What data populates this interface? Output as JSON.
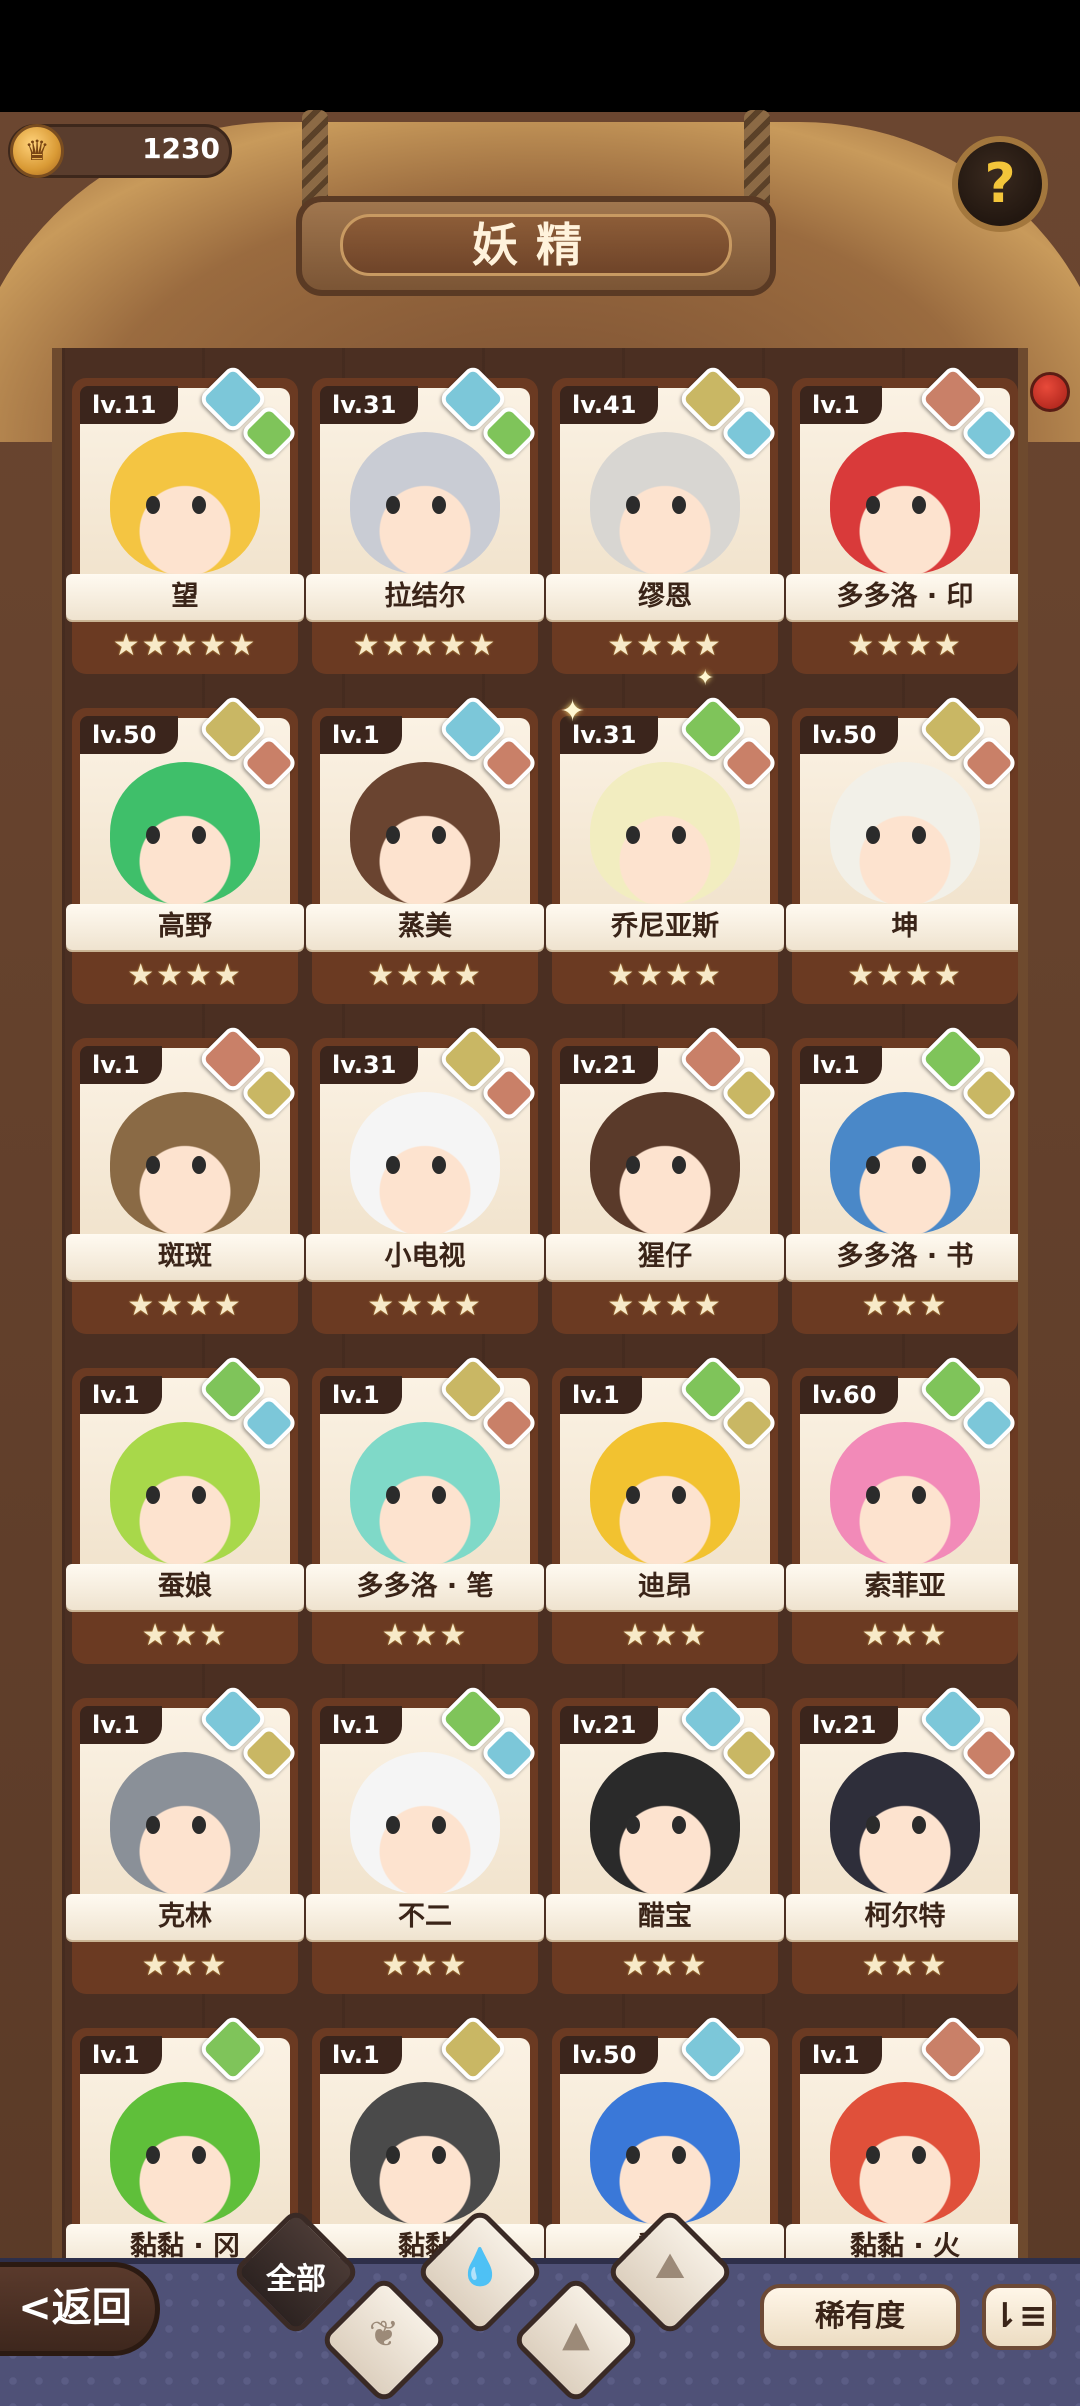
{
  "header": {
    "coins": "1230",
    "title": "妖精",
    "help_symbol": "?"
  },
  "elements": {
    "water": "#7cc7d9",
    "plant": "#7fc45a",
    "earth": "#c9b764",
    "fire": "#c98068"
  },
  "cards": [
    {
      "level": "lv.11",
      "name": "望",
      "stars": "★★★★★",
      "elements": [
        "water",
        "plant"
      ],
      "hair": "#f4c542"
    },
    {
      "level": "lv.31",
      "name": "拉结尔",
      "stars": "★★★★★",
      "elements": [
        "water",
        "plant"
      ],
      "hair": "#c9ccd4"
    },
    {
      "level": "lv.41",
      "name": "缪恩",
      "stars": "★★★★",
      "elements": [
        "earth",
        "water"
      ],
      "hair": "#d8d6d2"
    },
    {
      "level": "lv.1",
      "name": "多多洛 · 印",
      "stars": "★★★★",
      "elements": [
        "fire",
        "water"
      ],
      "hair": "#d93a3a"
    },
    {
      "level": "lv.50",
      "name": "高野",
      "stars": "★★★★",
      "elements": [
        "earth",
        "fire"
      ],
      "hair": "#3fbf6a"
    },
    {
      "level": "lv.1",
      "name": "蒸美",
      "stars": "★★★★",
      "elements": [
        "water",
        "fire"
      ],
      "hair": "#6a4430"
    },
    {
      "level": "lv.31",
      "name": "乔尼亚斯",
      "stars": "★★★★",
      "elements": [
        "plant",
        "fire"
      ],
      "hair": "#f2edc0"
    },
    {
      "level": "lv.50",
      "name": "坤",
      "stars": "★★★★",
      "elements": [
        "earth",
        "fire"
      ],
      "hair": "#f2f0e8"
    },
    {
      "level": "lv.1",
      "name": "斑斑",
      "stars": "★★★★",
      "elements": [
        "fire",
        "earth"
      ],
      "hair": "#8a6a45"
    },
    {
      "level": "lv.31",
      "name": "小电视",
      "stars": "★★★★",
      "elements": [
        "earth",
        "fire"
      ],
      "hair": "#f5f5f5"
    },
    {
      "level": "lv.21",
      "name": "猩仔",
      "stars": "★★★★",
      "elements": [
        "fire",
        "earth"
      ],
      "hair": "#5a3a2a"
    },
    {
      "level": "lv.1",
      "name": "多多洛 · 书",
      "stars": "★★★",
      "elements": [
        "plant",
        "earth"
      ],
      "hair": "#4a88c8"
    },
    {
      "level": "lv.1",
      "name": "蚕娘",
      "stars": "★★★",
      "elements": [
        "plant",
        "water"
      ],
      "hair": "#a8d84a"
    },
    {
      "level": "lv.1",
      "name": "多多洛 · 笔",
      "stars": "★★★",
      "elements": [
        "earth",
        "fire"
      ],
      "hair": "#7fd9c8"
    },
    {
      "level": "lv.1",
      "name": "迪昂",
      "stars": "★★★",
      "elements": [
        "plant",
        "earth"
      ],
      "hair": "#f2c230"
    },
    {
      "level": "lv.60",
      "name": "索菲亚",
      "stars": "★★★",
      "elements": [
        "plant",
        "water"
      ],
      "hair": "#f28ab8"
    },
    {
      "level": "lv.1",
      "name": "克林",
      "stars": "★★★",
      "elements": [
        "water",
        "earth"
      ],
      "hair": "#8a9098"
    },
    {
      "level": "lv.1",
      "name": "不二",
      "stars": "★★★",
      "elements": [
        "plant",
        "water"
      ],
      "hair": "#f5f5f5"
    },
    {
      "level": "lv.21",
      "name": "醋宝",
      "stars": "★★★",
      "elements": [
        "water",
        "earth"
      ],
      "hair": "#2a2a2a"
    },
    {
      "level": "lv.21",
      "name": "柯尔特",
      "stars": "★★★",
      "elements": [
        "water",
        "fire"
      ],
      "hair": "#2e2e3a"
    },
    {
      "level": "lv.1",
      "name": "黏黏 · 冈",
      "stars": "",
      "elements": [
        "plant"
      ],
      "hair": "#5fbf3a"
    },
    {
      "level": "lv.1",
      "name": "黏黏",
      "stars": "",
      "elements": [
        "earth"
      ],
      "hair": "#4a4a4a"
    },
    {
      "level": "lv.50",
      "name": "黏黏",
      "stars": "",
      "elements": [
        "water"
      ],
      "hair": "#3a78d8"
    },
    {
      "level": "lv.1",
      "name": "黏黏 · 火",
      "stars": "",
      "elements": [
        "fire"
      ],
      "hair": "#e0503a"
    }
  ],
  "bottom": {
    "back_label": "<返回",
    "filter_all_label": "全部",
    "rarity_label": "稀有度",
    "sort_symbol": "⇂≡"
  }
}
